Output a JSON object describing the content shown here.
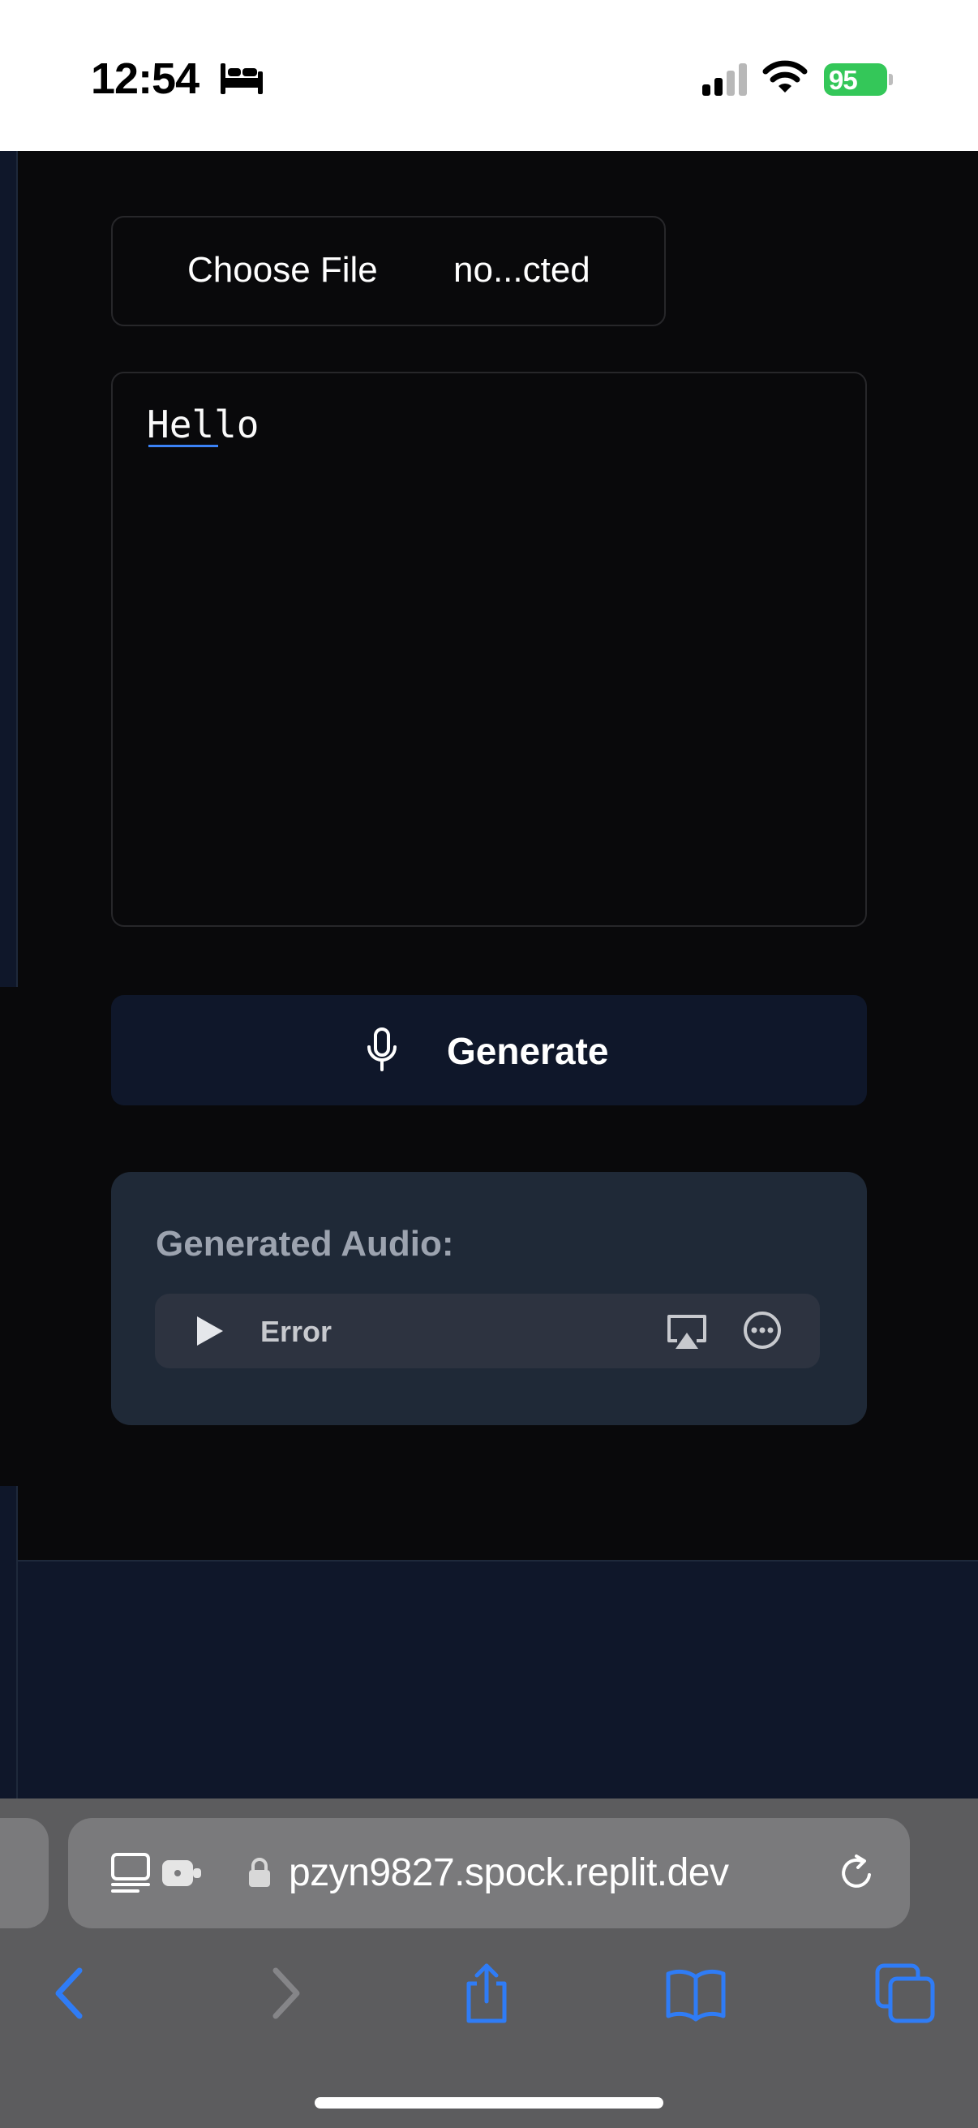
{
  "status_bar": {
    "time": "12:54",
    "battery_level": "95",
    "icons": [
      "bed-icon",
      "signal-icon",
      "wifi-icon",
      "battery-icon"
    ]
  },
  "form": {
    "choose_file_label": "Choose File",
    "file_status": "no...cted",
    "text_value": "Hello",
    "generate_label": "Generate",
    "generate_icon": "microphone-icon"
  },
  "audio": {
    "heading": "Generated Audio:",
    "status": "Error",
    "icons": [
      "play-icon",
      "airplay-icon",
      "more-icon"
    ]
  },
  "browser": {
    "url": "pzyn9827.spock.replit.dev",
    "icons": [
      "reader-icon",
      "extension-icon",
      "lock-icon",
      "reload-icon",
      "back-icon",
      "forward-icon",
      "share-icon",
      "bookmarks-icon",
      "tabs-icon"
    ]
  },
  "colors": {
    "accent": "#2f7cf6",
    "battery": "#34c759",
    "card": "#1f2937",
    "button": "#0f172a"
  }
}
